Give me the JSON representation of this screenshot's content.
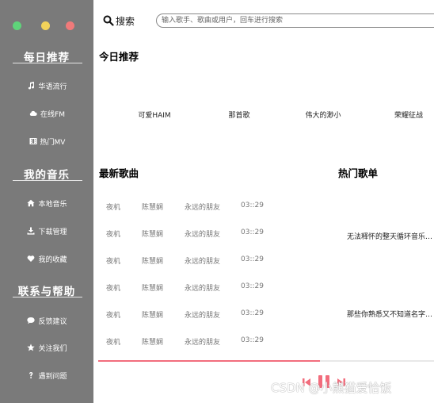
{
  "sidebar": {
    "sections": [
      {
        "title": "每日推荐",
        "items": [
          {
            "label": "华语流行",
            "icon": "music-note-icon"
          },
          {
            "label": "在线FM",
            "icon": "cloud-icon"
          },
          {
            "label": "热门MV",
            "icon": "film-icon"
          }
        ]
      },
      {
        "title": "我的音乐",
        "items": [
          {
            "label": "本地音乐",
            "icon": "home-icon"
          },
          {
            "label": "下载管理",
            "icon": "download-icon"
          },
          {
            "label": "我的收藏",
            "icon": "heart-icon"
          }
        ]
      },
      {
        "title": "联系与帮助",
        "items": [
          {
            "label": "反馈建议",
            "icon": "comment-icon"
          },
          {
            "label": "关注我们",
            "icon": "star-icon"
          },
          {
            "label": "遇到问题",
            "icon": "question-icon"
          }
        ]
      }
    ]
  },
  "search": {
    "label": "搜索",
    "placeholder": "输入歌手、歌曲或用户，回车进行搜索"
  },
  "today": {
    "title": "今日推荐",
    "items": [
      "可爱HAIM",
      "那首歌",
      "伟大的渺小",
      "荣耀征战"
    ]
  },
  "latest": {
    "title": "最新歌曲",
    "songs": [
      {
        "title": "夜机",
        "artist": "陈慧娴",
        "album": "永远的朋友",
        "time": "03::29"
      },
      {
        "title": "夜机",
        "artist": "陈慧娴",
        "album": "永远的朋友",
        "time": "03::29"
      },
      {
        "title": "夜机",
        "artist": "陈慧娴",
        "album": "永远的朋友",
        "time": "03::29"
      },
      {
        "title": "夜机",
        "artist": "陈慧娴",
        "album": "永远的朋友",
        "time": "03::29"
      },
      {
        "title": "夜机",
        "artist": "陈慧娴",
        "album": "永远的朋友",
        "time": "03::29"
      },
      {
        "title": "夜机",
        "artist": "陈慧娴",
        "album": "永远的朋友",
        "time": "03::29"
      }
    ]
  },
  "hot": {
    "title": "热门歌单",
    "playlists": [
      "无法释怀的整天循环音乐…",
      "那些你熟悉又不知道名字…"
    ]
  },
  "player": {
    "progress": 0.66,
    "accent": "#f26d7d"
  },
  "watermark": "CSDN @小熊猫爱恰饭"
}
